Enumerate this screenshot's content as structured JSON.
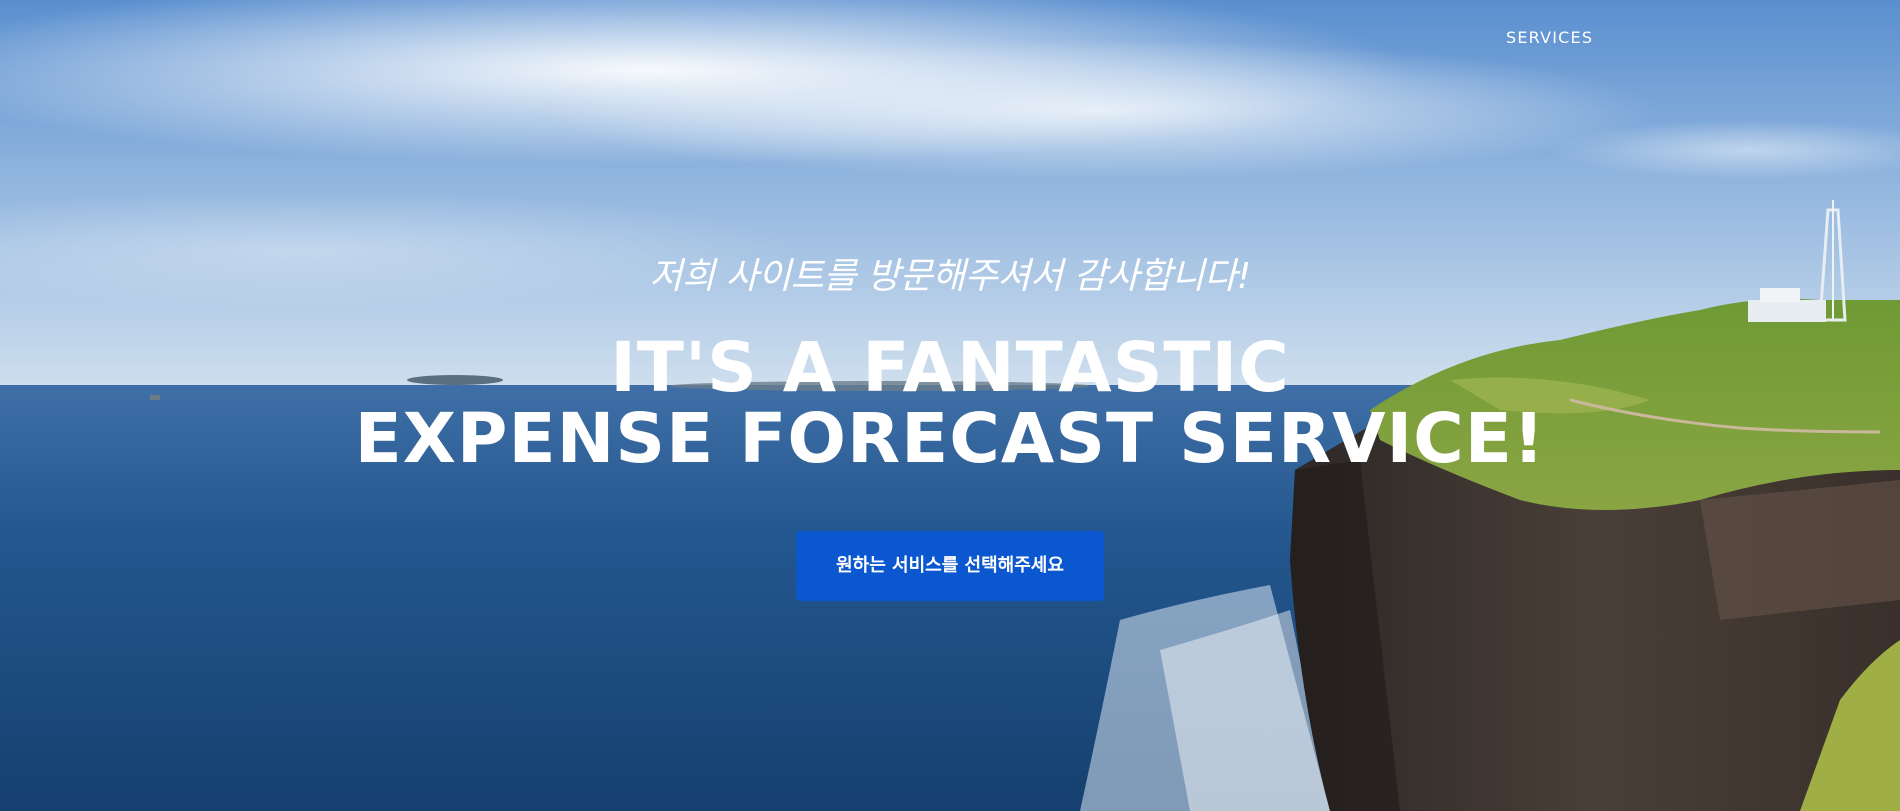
{
  "nav": {
    "services_label": "SERVICES"
  },
  "hero": {
    "subheading": "저희 사이트를 방문해주셔서 감사합니다!",
    "heading_line1": "IT'S A FANTASTIC",
    "heading_line2": "EXPENSE FORECAST SERVICE!",
    "cta_label": "원하는 서비스를 선택해주세요",
    "background_description_colors": {
      "sky": "#7fa7d6",
      "sea": "#1f4f86",
      "cliff": "#3a3430",
      "grass": "#7f9b3b"
    },
    "cta_color": "#0b57d0"
  }
}
